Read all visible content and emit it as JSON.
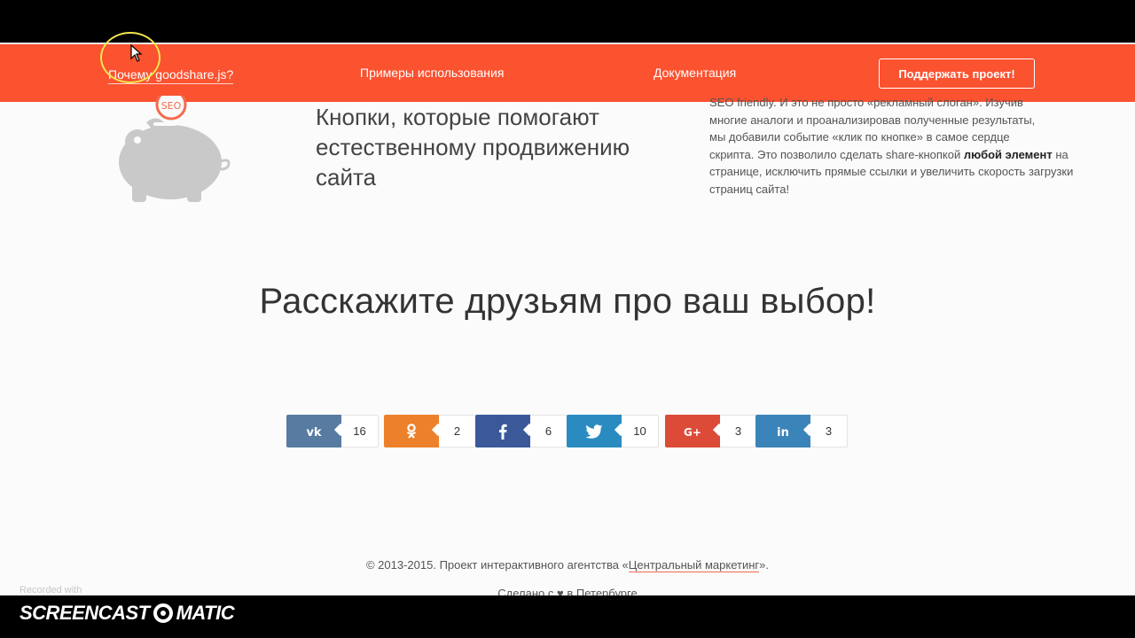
{
  "nav": {
    "why": "Почему goodshare.js?",
    "examples": "Примеры использования",
    "docs": "Документация",
    "support": "Поддержать проект!"
  },
  "feature": {
    "headline": "Кнопки, которые помогают естественному продвижению сайта",
    "desc_line0": "SEO friendly. И это не просто «рекламный слоган». Изучив",
    "desc_line1": "многие аналоги и проанализировав полученные результаты,",
    "desc_line2": "мы добавили событие «клик по кнопке» в самое сердце",
    "desc_line3_a": "скрипта. Это позволило сделать share-кнопкой",
    "desc_bold": "любой элемент",
    "desc_line3_b": "на странице, исключить прямые ссылки и увеличить",
    "desc_line4": "скорость загрузки страниц сайта!",
    "badge": "SEO"
  },
  "share_title": "Расскажите друзьям про ваш выбор!",
  "shares": [
    {
      "network": "vk",
      "icon": "vk-icon",
      "symbol": "vk",
      "count": "16",
      "color": "#587ba1"
    },
    {
      "network": "ok",
      "icon": "odnoklassniki-icon",
      "symbol": "ok",
      "count": "2",
      "color": "#ed812b"
    },
    {
      "network": "facebook",
      "icon": "facebook-icon",
      "symbol": "f",
      "count": "6",
      "color": "#3b5998"
    },
    {
      "network": "twitter",
      "icon": "twitter-icon",
      "symbol": "tw",
      "count": "10",
      "color": "#2a8bc0"
    },
    {
      "network": "googleplus",
      "icon": "google-plus-icon",
      "symbol": "G+",
      "count": "3",
      "color": "#dc4a38"
    },
    {
      "network": "linkedin",
      "icon": "linkedin-icon",
      "symbol": "in",
      "count": "3",
      "color": "#3b84b9"
    }
  ],
  "footer": {
    "copyright_prefix": "© 2013-2015. Проект интерактивного агентства «",
    "agency": "Центральный маркетинг",
    "copyright_suffix": "».",
    "made_with_a": "Сделано с",
    "made_with_b": "в Петербурге"
  },
  "watermark": {
    "recorded": "Recorded with",
    "brand_a": "SCREENCAST",
    "brand_b": "MATIC"
  },
  "colors": {
    "nav_bg": "#fb5230",
    "accent": "#f36b4e"
  }
}
